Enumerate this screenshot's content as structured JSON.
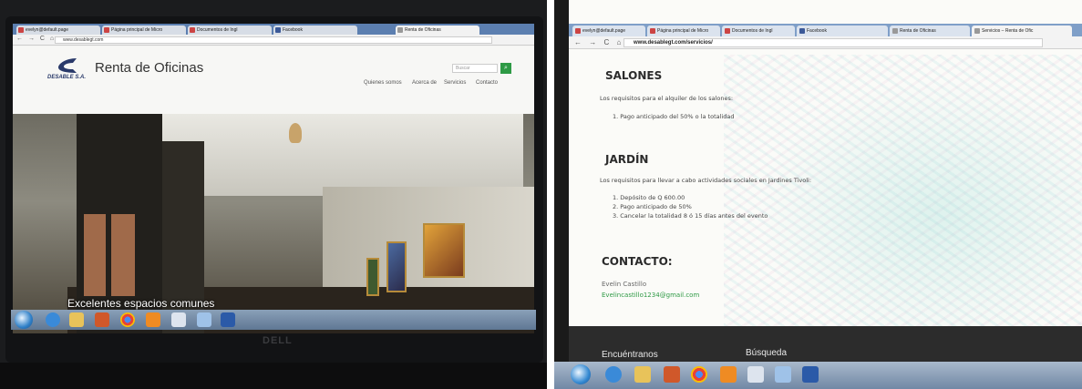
{
  "left_photo": {
    "browser": {
      "tabs": [
        "evelyn@default.page",
        "Página principal de Micro",
        "Documentos de Ingl",
        "Facebook",
        "Renta de Oficinas"
      ],
      "url": "www.desablegt.com"
    },
    "site": {
      "logo_text": "DESABLE S.A.",
      "title": "Renta de Oficinas",
      "search_placeholder": "Buscar",
      "menu": [
        "Quienes somos",
        "Acerca de",
        "Servicios",
        "Contacto"
      ],
      "hero_caption": "Excelentes espacios comunes"
    },
    "monitor_brand": "DELL"
  },
  "right_photo": {
    "browser": {
      "tabs": [
        "evelyn@default.page",
        "Página principal de Micro",
        "Documentos de Ingl",
        "Facebook",
        "Renta de Oficinas",
        "Servicios – Renta de Ofic"
      ],
      "url": "www.desablegt.com/servicios/"
    },
    "salones": {
      "heading": "SALONES",
      "intro": "Los requisitos para el alquiler de los salones:",
      "items": [
        "1. Pago anticipado del 50% o la totalidad"
      ]
    },
    "jardin": {
      "heading": "JARDÍN",
      "intro": "Los requisitos para llevar a cabo actividades sociales en Jardines Tivoli:",
      "items": [
        "1. Depósito de Q 600.00",
        "2. Pago anticipado de 50%",
        "3. Cancelar la totalidad 8 ó 15 días antes del evento"
      ]
    },
    "contacto": {
      "heading": "CONTACTO:",
      "name": "Evelin Castillo",
      "email": "Evelincastillo1234@gmail.com"
    },
    "footer": {
      "col1": "Encuéntranos",
      "col2": "Búsqueda"
    }
  },
  "colors": {
    "accent_green": "#2e9a45",
    "taskbar_blue": "#5f7794",
    "footer_dark": "#2c2c2c"
  }
}
